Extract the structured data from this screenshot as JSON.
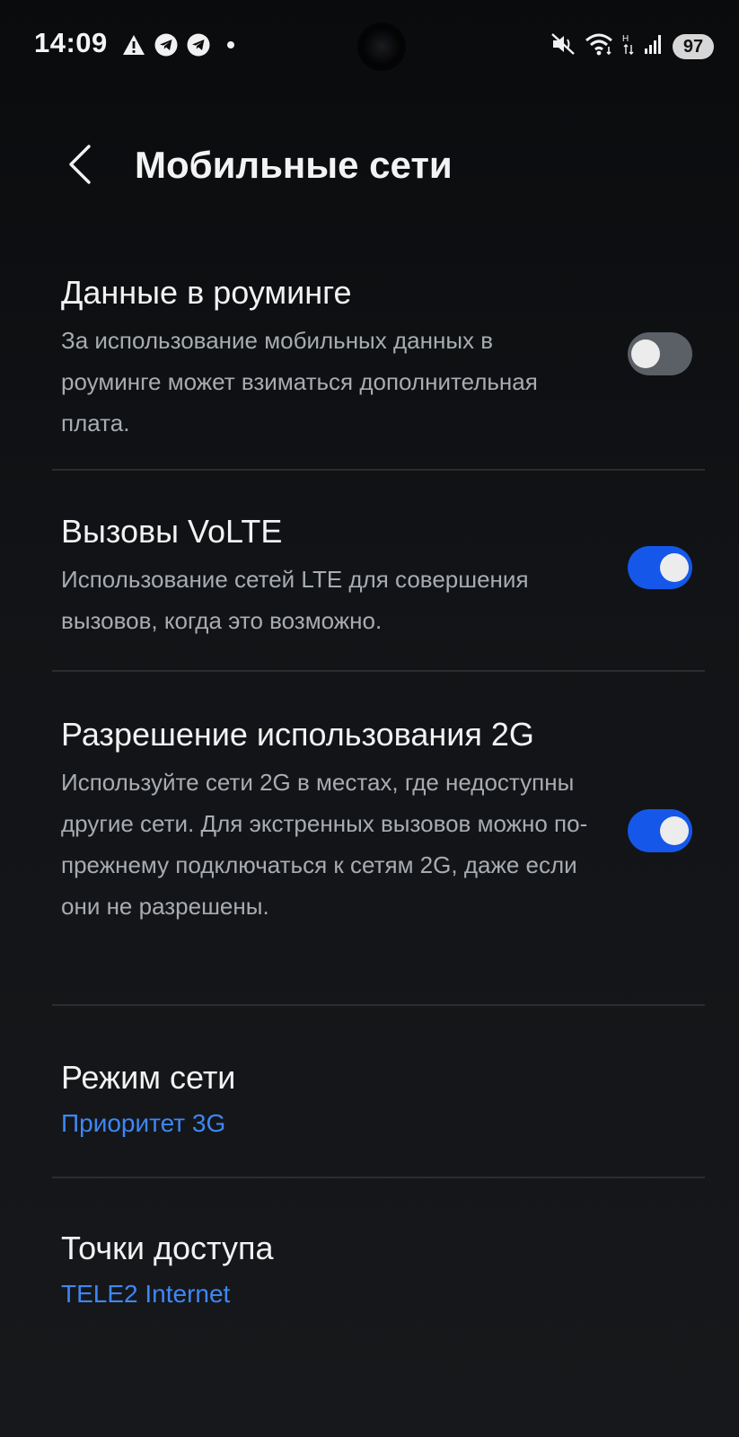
{
  "status_bar": {
    "time": "14:09",
    "battery": "97",
    "left_icons": [
      "warning-icon",
      "telegram-icon",
      "telegram-icon",
      "dot-icon"
    ],
    "right_icons": [
      "mute-vibrate-icon",
      "wifi-icon",
      "mobile-data-icon",
      "signal-icon"
    ]
  },
  "header": {
    "title": "Мобильные сети"
  },
  "settings": {
    "roaming": {
      "title": "Данные в роуминге",
      "description": "За использование мобильных данных в роуминге может взиматься дополнительная плата.",
      "enabled": false
    },
    "volte": {
      "title": "Вызовы VoLTE",
      "description": "Использование сетей LTE для совершения вызовов, когда это возможно.",
      "enabled": true
    },
    "allow_2g": {
      "title": "Разрешение использования 2G",
      "description": "Используйте сети 2G в местах, где недоступны другие сети. Для экстренных вызовов можно по-прежнему подключаться к сетям 2G, даже если они не разрешены.",
      "enabled": true
    },
    "network_mode": {
      "title": "Режим сети",
      "value": "Приоритет 3G"
    },
    "access_points": {
      "title": "Точки доступа",
      "value": "TELE2 Internet"
    }
  },
  "colors": {
    "accent": "#3f86f5",
    "toggle_on": "#1557e8",
    "toggle_off": "#5b5f66",
    "background": "#0f1113"
  }
}
